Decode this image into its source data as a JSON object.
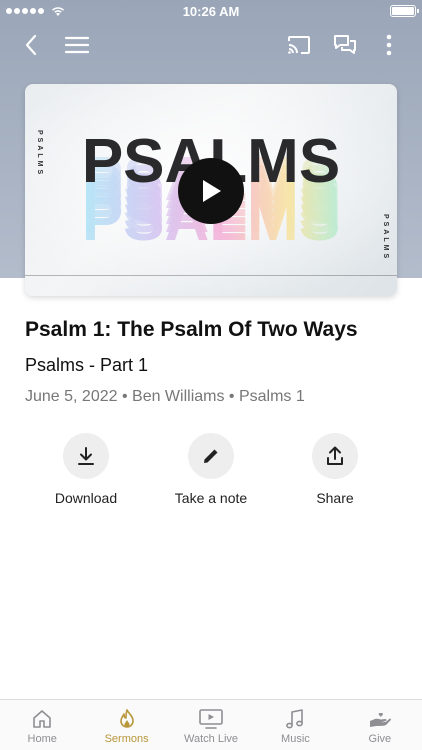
{
  "status_bar": {
    "time": "10:26 AM"
  },
  "nav": {
    "icons": [
      "back-chevron-icon",
      "menu-icon",
      "cast-icon",
      "chat-icon",
      "more-icon"
    ]
  },
  "video": {
    "art_text": "PSALMS",
    "side_text": "PSALMS"
  },
  "sermon": {
    "title": "Psalm 1: The Psalm Of Two Ways",
    "series": "Psalms - Part 1",
    "meta": "June 5, 2022 • Ben Williams • Psalms 1"
  },
  "actions": [
    {
      "label": "Download",
      "icon": "download-icon"
    },
    {
      "label": "Take a note",
      "icon": "pencil-icon"
    },
    {
      "label": "Share",
      "icon": "share-icon"
    }
  ],
  "tabs": [
    {
      "label": "Home",
      "icon": "home-icon"
    },
    {
      "label": "Sermons",
      "icon": "flame-icon",
      "active": true
    },
    {
      "label": "Watch Live",
      "icon": "tv-icon"
    },
    {
      "label": "Music",
      "icon": "music-icon"
    },
    {
      "label": "Give",
      "icon": "give-icon"
    }
  ],
  "colors": {
    "accent": "#b8973a",
    "hero_bg": "#a9b3c3"
  }
}
